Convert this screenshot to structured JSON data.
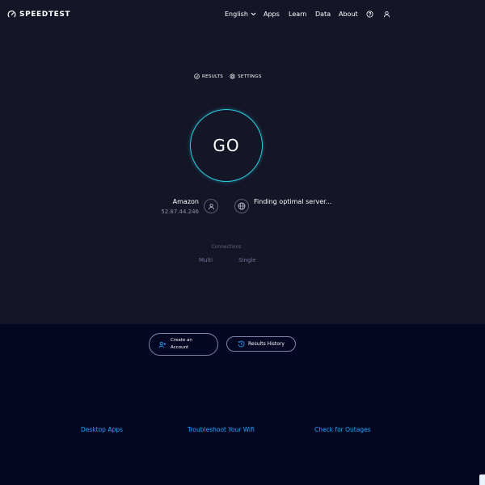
{
  "brand": {
    "name": "SPEEDTEST"
  },
  "nav": {
    "language": "English",
    "apps": "Apps",
    "learn": "Learn",
    "data": "Data",
    "about": "About"
  },
  "tabs": {
    "results": "RESULTS",
    "settings": "SETTINGS"
  },
  "go": {
    "label": "GO"
  },
  "isp": {
    "name": "Amazon",
    "ip": "52.87.44.246"
  },
  "server": {
    "status": "Finding optimal server..."
  },
  "connections": {
    "label": "Connections",
    "multi": "Multi",
    "single": "Single"
  },
  "buttons": {
    "create_account": "Create an Account",
    "results_history": "Results History"
  },
  "footer": {
    "links": [
      "Desktop Apps",
      "Troubleshoot Your Wifi",
      "Check for Outages"
    ]
  },
  "colors": {
    "background": "#141526",
    "footer_background": "#050723",
    "accent_ring": "#2ad1e6",
    "link": "#1ea7ff"
  }
}
